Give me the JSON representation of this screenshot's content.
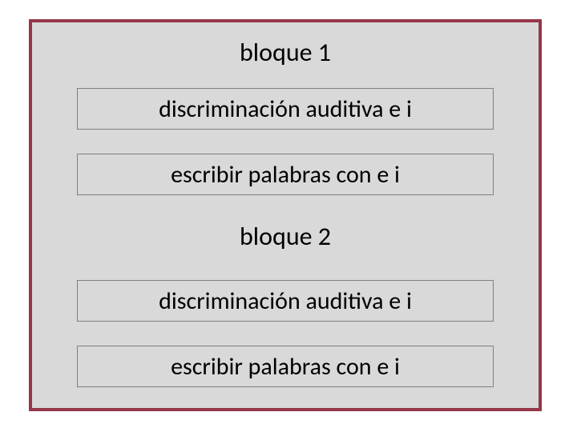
{
  "block1": {
    "title": "bloque 1",
    "items": [
      "discriminación auditiva  e  i",
      "escribir  palabras  con   e   i"
    ]
  },
  "block2": {
    "title": "bloque 2",
    "items": [
      "discriminación auditiva  e  i",
      "escribir  palabras  con   e   i"
    ]
  }
}
